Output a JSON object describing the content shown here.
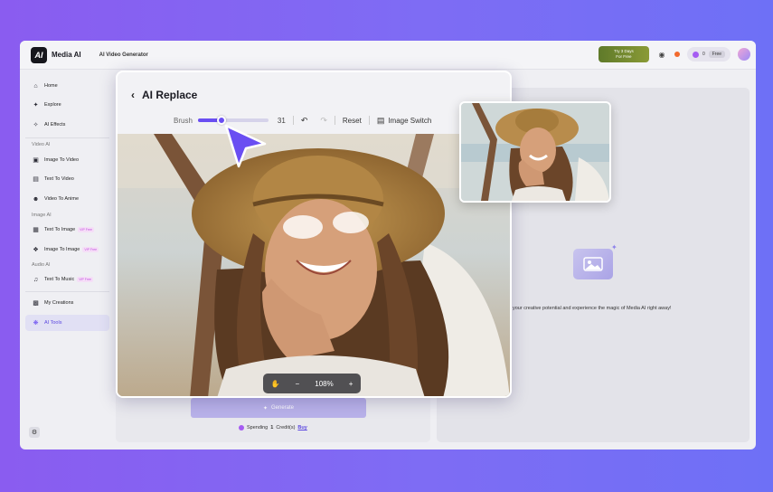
{
  "app": {
    "brand": "Media AI",
    "logo": "AI",
    "nav_item": "AI Video Generator",
    "promo_line1": "Try 3 Days",
    "promo_line2": "For Free",
    "credits": "0",
    "plan": "Free"
  },
  "sidebar": {
    "items": [
      {
        "label": "Home",
        "icon": "home-icon"
      },
      {
        "label": "Explore",
        "icon": "compass-icon"
      },
      {
        "label": "AI Effects",
        "icon": "sparkle-icon"
      }
    ],
    "video_group": "Video AI",
    "video_items": [
      {
        "label": "Image To Video"
      },
      {
        "label": "Text To Video"
      },
      {
        "label": "Video To Anime"
      }
    ],
    "image_group": "Image AI",
    "image_items": [
      {
        "label": "Text To Image",
        "badge": "VIP Free"
      },
      {
        "label": "Image To Image",
        "badge": "VIP Free"
      }
    ],
    "audio_group": "Audio AI",
    "audio_items": [
      {
        "label": "Text To Music",
        "badge": "VIP Free"
      }
    ],
    "my_creations": "My Creations",
    "ai_tools": "AI Tools"
  },
  "main": {
    "generate_label": "Generate",
    "spending_prefix": "Spending",
    "spending_amount": "1",
    "spending_suffix": "Credit(s)",
    "buy_label": "Buy",
    "tagline": "your creative potential and experience the magic of Media AI right away!"
  },
  "modal": {
    "title": "AI Replace",
    "brush_label": "Brush",
    "brush_value": "31",
    "brush_fraction": 0.33,
    "reset_label": "Reset",
    "image_switch_label": "Image Switch",
    "zoom": "108%",
    "zoom_minus": "−",
    "zoom_plus": "+"
  },
  "colors": {
    "accent": "#6a4ef2",
    "background_gradient_start": "#8a5cf0",
    "background_gradient_end": "#6e70f6"
  }
}
